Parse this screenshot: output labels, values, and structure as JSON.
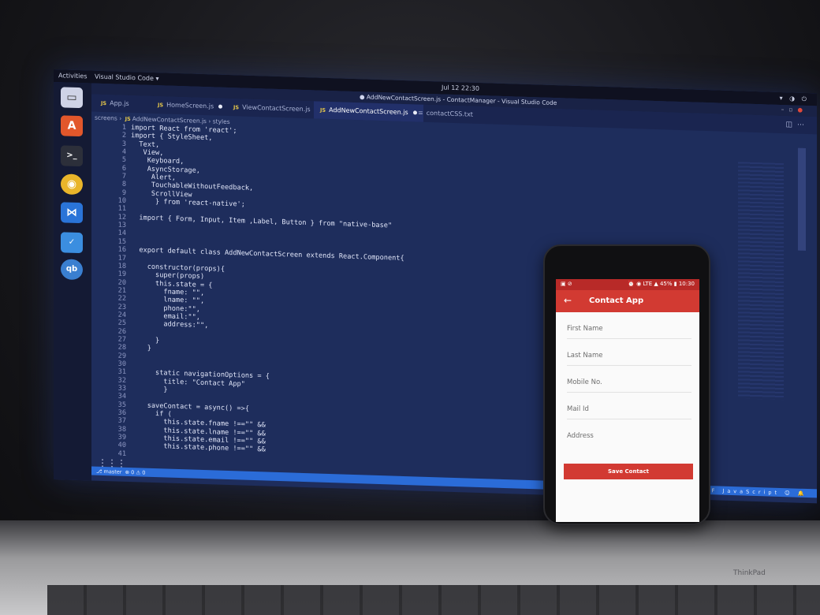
{
  "topbar": {
    "activities": "Activities",
    "app_menu": "Visual Studio Code ▾",
    "clock": "Jul 12  22:30",
    "system_icons": "▾ ◑ ⏻"
  },
  "window": {
    "title": "● AddNewContactScreen.js - ContactManager - Visual Studio Code"
  },
  "tabs": [
    {
      "label": "App.js",
      "type": "JS"
    },
    {
      "label": "HomeScreen.js",
      "type": "JS",
      "modified": true
    },
    {
      "label": "ViewContactScreen.js",
      "type": "JS"
    },
    {
      "label": "AddNewContactScreen.js",
      "type": "JS",
      "modified": true,
      "active": true
    },
    {
      "label": "contactCSS.txt",
      "type": "txt"
    }
  ],
  "breadcrumb": {
    "folder": "screens",
    "file": "AddNewContactScreen.js",
    "symbol": "styles"
  },
  "editor": {
    "line_numbers": "1\n2\n3\n4\n5\n6\n7\n8\n9\n10\n11\n12\n13\n14\n15\n16\n17\n18\n19\n20\n21\n22\n23\n24\n25\n26\n27\n28\n29\n30\n31\n32\n33\n34\n35\n36\n37\n38\n39\n40\n41",
    "lines": [
      "import React from 'react';",
      "import { StyleSheet,",
      "  Text,",
      "   View,",
      "    Keyboard,",
      "    AsyncStorage,",
      "     Alert,",
      "     TouchableWithoutFeedback,",
      "     ScrollView",
      "      } from 'react-native';",
      "",
      "  import { Form, Input, Item ,Label, Button } from \"native-base\"",
      "",
      "",
      "",
      "  export default class AddNewContactScreen extends React.Component{",
      "",
      "    constructor(props){",
      "      super(props)",
      "      this.state = {",
      "        fname: \"\",",
      "        lname: \"\",",
      "        phone:\"\",",
      "        email:\"\",",
      "        address:\"\",",
      "",
      "      }",
      "    }",
      "",
      "",
      "      static navigationOptions = {",
      "        title: \"Contact App\"",
      "        }",
      "",
      "    saveContact = async() =>{",
      "      if (",
      "        this.state.fname !==\"\" &&",
      "        this.state.lname !==\"\" &&",
      "        this.state.email !==\"\" &&",
      "        this.state.phone !==\"\" &&",
      ""
    ]
  },
  "statusbar": {
    "branch": "⎇ master",
    "problems": "⊗ 0 ⚠ 0",
    "right": "LF  JavaScript  ☺  🔔"
  },
  "phone": {
    "status_left": "▣ ⊘",
    "status_right": "⏰ ◉ LTE ▲ 45% ▮ 10:30",
    "appbar_title": "Contact App",
    "fields": [
      "First Name",
      "Last Name",
      "Mobile No.",
      "Mail Id",
      "Address"
    ],
    "button_label": "Save Contact"
  },
  "watermark": "ThinkPad"
}
